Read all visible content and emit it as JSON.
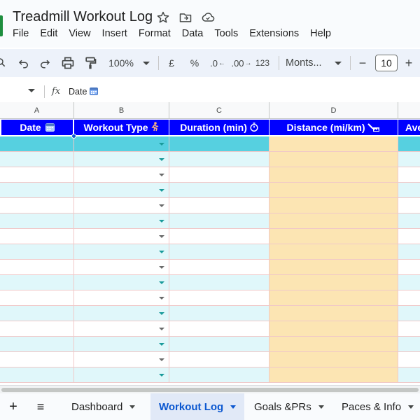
{
  "app": {
    "title": "Treadmill Workout Log",
    "menu": [
      "File",
      "Edit",
      "View",
      "Insert",
      "Format",
      "Data",
      "Tools",
      "Extensions",
      "Help"
    ]
  },
  "toolbar": {
    "zoom": "100%",
    "currency": "£",
    "percent": "%",
    "dec_decrease": ".0",
    "dec_increase": ".00",
    "number_format": "123",
    "font": "Monts...",
    "font_size_minus": "−",
    "font_size": "10",
    "font_size_plus": "+"
  },
  "formula_bar": {
    "fx": "fx",
    "content": "Date"
  },
  "columns": [
    {
      "letter": "A",
      "header": "Date",
      "icon": "calendar-icon"
    },
    {
      "letter": "B",
      "header": "Workout Type",
      "icon": "runner-icon"
    },
    {
      "letter": "C",
      "header": "Duration (min)",
      "icon": "stopwatch-icon"
    },
    {
      "letter": "D",
      "header": "Distance (mi/km)",
      "icon": "ruler-icon"
    },
    {
      "letter": "",
      "header": "Ave",
      "icon": ""
    }
  ],
  "colors": {
    "header_bg": "#0000ff",
    "selected_row": "#56d0e0",
    "stripe_row": "#e0f7fa",
    "distance_col": "#fce5b3",
    "dropdown_teal": "#1a9b9b",
    "active_tab": "#0b57d0"
  },
  "sheets": {
    "add": "+",
    "list": "≡",
    "tabs": [
      {
        "label": "Dashboard",
        "active": false
      },
      {
        "label": "Workout Log",
        "active": true
      },
      {
        "label": "Goals &PRs",
        "active": false
      },
      {
        "label": "Paces & Info",
        "active": false
      }
    ]
  }
}
